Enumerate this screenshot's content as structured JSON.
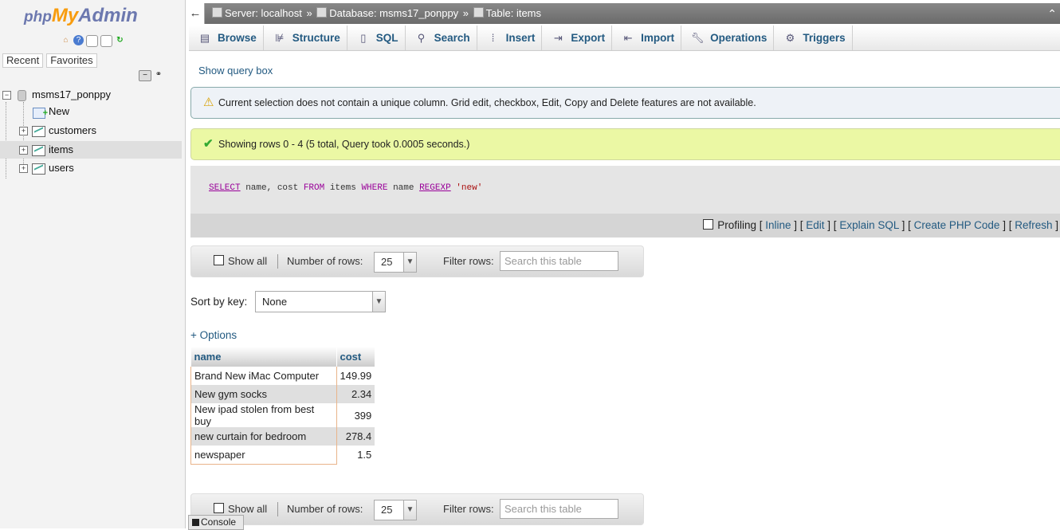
{
  "app": {
    "logo": {
      "php": "php",
      "my": "My",
      "admin": "Admin"
    }
  },
  "sidebar": {
    "tabs": [
      "Recent",
      "Favorites"
    ],
    "database": "msms17_ponppy",
    "items": [
      "New",
      "customers",
      "items",
      "users"
    ],
    "selected": "items"
  },
  "breadcrumb": {
    "server": "Server: localhost",
    "database": "Database: msms17_ponppy",
    "table": "Table: items"
  },
  "tabs": [
    "Browse",
    "Structure",
    "SQL",
    "Search",
    "Insert",
    "Export",
    "Import",
    "Operations",
    "Triggers"
  ],
  "content": {
    "show_query_box": "Show query box",
    "notice": "Current selection does not contain a unique column. Grid edit, checkbox, Edit, Copy and Delete features are not available.",
    "success": "Showing rows 0 - 4 (5 total, Query took 0.0005 seconds.)",
    "sql": {
      "select": "SELECT",
      "cols": " name, cost ",
      "from": "FROM",
      "table": " items ",
      "where": "WHERE",
      "col": " name ",
      "regexp": "REGEXP",
      "value": "'new'"
    },
    "sql_links": {
      "profiling": "Profiling",
      "inline": "Inline",
      "edit": "Edit",
      "explain": "Explain SQL",
      "php": "Create PHP Code",
      "refresh": "Refresh"
    },
    "nav": {
      "show_all": "Show all",
      "num_rows_label": "Number of rows:",
      "num_rows_value": "25",
      "filter_label": "Filter rows:",
      "filter_placeholder": "Search this table"
    },
    "sort_label": "Sort by key:",
    "sort_value": "None",
    "options": "+ Options",
    "table": {
      "headers": [
        "name",
        "cost"
      ],
      "rows": [
        [
          "Brand New iMac Computer",
          "149.99"
        ],
        [
          "New gym socks",
          "2.34"
        ],
        [
          "New ipad stolen from best buy",
          "399"
        ],
        [
          "new curtain for bedroom",
          "278.4"
        ],
        [
          "newspaper",
          "1.5"
        ]
      ]
    },
    "console": "Console"
  }
}
